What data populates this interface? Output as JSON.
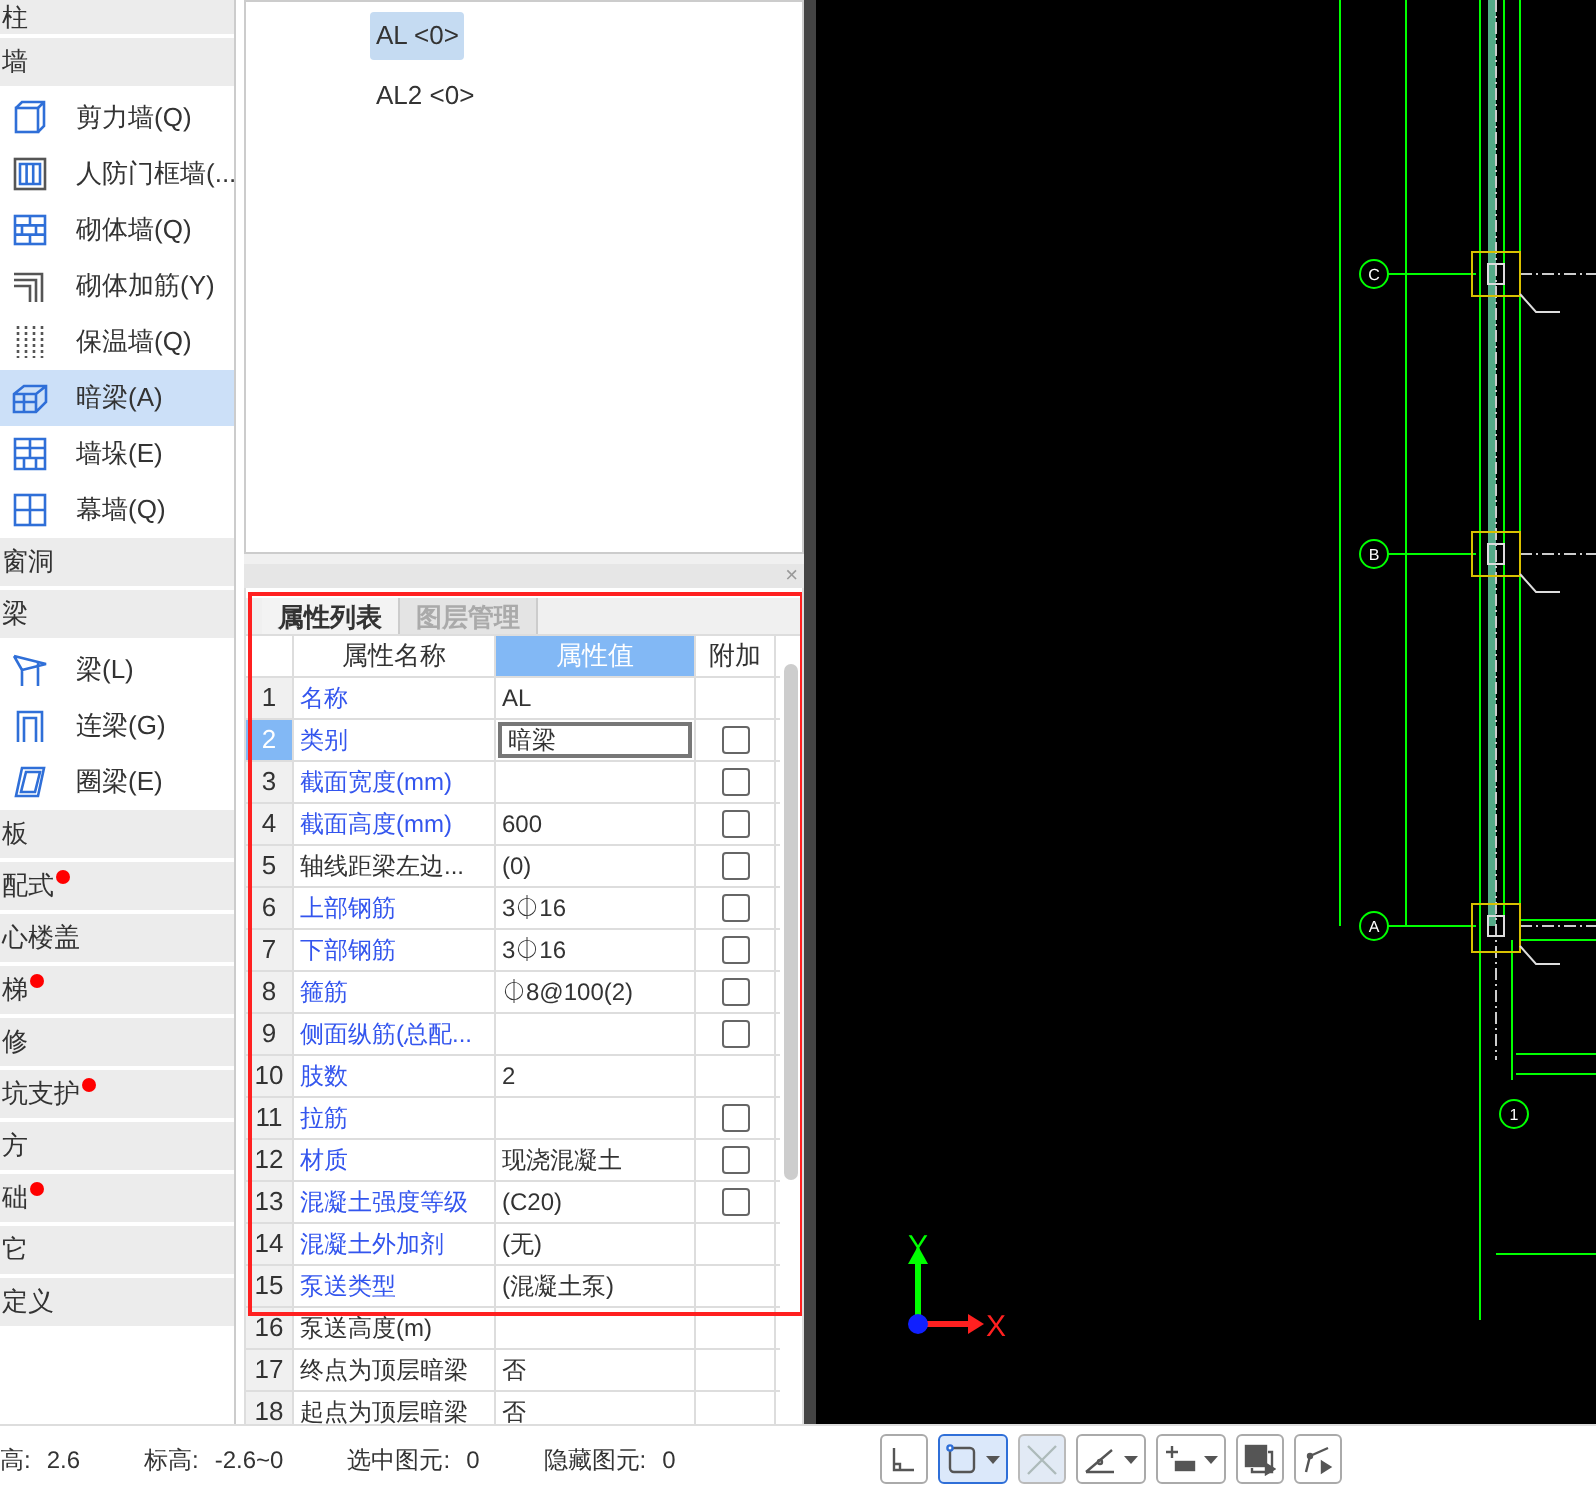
{
  "sidebar": {
    "groups": [
      {
        "label": "柱",
        "dot": false
      },
      {
        "label": "墙",
        "dot": false,
        "items": [
          {
            "label": "剪力墙(Q)",
            "selected": false
          },
          {
            "label": "人防门框墙(...",
            "selected": false
          },
          {
            "label": "砌体墙(Q)",
            "selected": false
          },
          {
            "label": "砌体加筋(Y)",
            "selected": false
          },
          {
            "label": "保温墙(Q)",
            "selected": false
          },
          {
            "label": "暗梁(A)",
            "selected": true
          },
          {
            "label": "墙垛(E)",
            "selected": false
          },
          {
            "label": "幕墙(Q)",
            "selected": false
          }
        ]
      },
      {
        "label": "窗洞",
        "dot": false
      },
      {
        "label": "梁",
        "dot": false,
        "items": [
          {
            "label": "梁(L)",
            "selected": false
          },
          {
            "label": "连梁(G)",
            "selected": false
          },
          {
            "label": "圈梁(E)",
            "selected": false
          }
        ]
      },
      {
        "label": "板",
        "dot": false
      },
      {
        "label": "配式",
        "dot": true
      },
      {
        "label": "心楼盖",
        "dot": false
      },
      {
        "label": "梯",
        "dot": true
      },
      {
        "label": "修",
        "dot": false
      },
      {
        "label": "坑支护",
        "dot": true
      },
      {
        "label": "方",
        "dot": false
      },
      {
        "label": "础",
        "dot": true
      },
      {
        "label": "它",
        "dot": false
      },
      {
        "label": "定义",
        "dot": false
      }
    ]
  },
  "component_list": [
    {
      "label": "AL <0>",
      "selected": true
    },
    {
      "label": "AL2 <0>",
      "selected": false
    }
  ],
  "properties": {
    "close": "×",
    "tabs": [
      {
        "label": "属性列表",
        "selected": true
      },
      {
        "label": "图层管理",
        "selected": false
      }
    ],
    "columns": [
      {
        "label": "属性名称",
        "selected": false
      },
      {
        "label": "属性值",
        "selected": true
      },
      {
        "label": "附加",
        "selected": false
      }
    ],
    "rows": [
      {
        "n": "1",
        "name": "名称",
        "value": "AL",
        "linked": true,
        "selected": false
      },
      {
        "n": "2",
        "name": "类别",
        "value": "暗梁",
        "linked": true,
        "checked": false,
        "selected": true
      },
      {
        "n": "3",
        "name": "截面宽度(mm)",
        "linked": true,
        "checked": false,
        "selected": false
      },
      {
        "n": "4",
        "name": "截面高度(mm)",
        "value": "600",
        "linked": true,
        "checked": false,
        "selected": false
      },
      {
        "n": "5",
        "name": "轴线距梁左边...",
        "value": "(0)",
        "linked": false,
        "checked": false,
        "selected": false
      },
      {
        "n": "6",
        "name": "上部钢筋",
        "value": "3⏀16",
        "linked": true,
        "checked": false,
        "selected": false
      },
      {
        "n": "7",
        "name": "下部钢筋",
        "value": "3⏀16",
        "linked": true,
        "checked": false,
        "selected": false
      },
      {
        "n": "8",
        "name": "箍筋",
        "value": "⏀8@100(2)",
        "linked": true,
        "checked": false,
        "selected": false
      },
      {
        "n": "9",
        "name": "侧面纵筋(总配...",
        "linked": true,
        "checked": false,
        "selected": false
      },
      {
        "n": "10",
        "name": "肢数",
        "value": "2",
        "linked": true,
        "selected": false
      },
      {
        "n": "11",
        "name": "拉筋",
        "linked": true,
        "checked": false,
        "selected": false
      },
      {
        "n": "12",
        "name": "材质",
        "value": "现浇混凝土",
        "linked": true,
        "checked": false,
        "selected": false
      },
      {
        "n": "13",
        "name": "混凝土强度等级",
        "value": "(C20)",
        "linked": true,
        "checked": false,
        "selected": false
      },
      {
        "n": "14",
        "name": "混凝土外加剂",
        "value": "(无)",
        "linked": true,
        "selected": false
      },
      {
        "n": "15",
        "name": "泵送类型",
        "value": "(混凝土泵)",
        "linked": true,
        "selected": false
      },
      {
        "n": "16",
        "name": "泵送高度(m)",
        "linked": false,
        "selected": false
      },
      {
        "n": "17",
        "name": "终点为顶层暗梁",
        "value": "否",
        "linked": false,
        "selected": false
      },
      {
        "n": "18",
        "name": "起点为顶层暗梁",
        "value": "否",
        "linked": false,
        "selected": false
      }
    ]
  },
  "canvas": {
    "axes": [
      {
        "label": "C"
      },
      {
        "label": "B"
      },
      {
        "label": "A"
      },
      {
        "label": "1"
      }
    ],
    "ucs": {
      "y": "Y",
      "x": "X"
    }
  },
  "status_bar": [
    {
      "label": "高:",
      "value": "2.6"
    },
    {
      "label": "标高:",
      "value": "-2.6~0"
    },
    {
      "label": "选中图元:",
      "value": "0"
    },
    {
      "label": "隐藏图元:",
      "value": "0"
    }
  ],
  "toolbar": [
    {
      "kind": "ortho",
      "dropdown": false,
      "selected": false,
      "disabled": false
    },
    {
      "kind": "rect-select",
      "dropdown": true,
      "selected": true,
      "disabled": false
    },
    {
      "kind": "cross",
      "dropdown": false,
      "selected": false,
      "disabled": true
    },
    {
      "kind": "angle",
      "dropdown": true,
      "selected": false,
      "disabled": false
    },
    {
      "kind": "dimension",
      "dropdown": true,
      "selected": false,
      "disabled": false
    },
    {
      "kind": "layers",
      "dropdown": false,
      "selected": false,
      "disabled": false
    },
    {
      "kind": "polyline",
      "dropdown": false,
      "selected": false,
      "disabled": false
    }
  ]
}
